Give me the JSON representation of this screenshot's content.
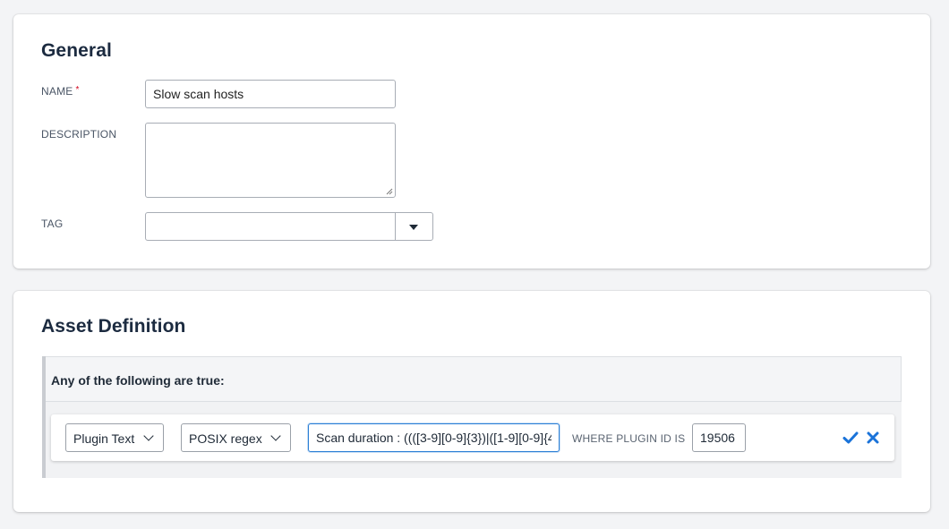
{
  "general": {
    "title": "General",
    "name_label": "NAME",
    "required_marker": "*",
    "name_value": "Slow scan hosts",
    "description_label": "DESCRIPTION",
    "description_value": "",
    "tag_label": "TAG",
    "tag_value": ""
  },
  "asset_definition": {
    "title": "Asset Definition",
    "condition_header": "Any of the following are true:",
    "rule": {
      "field_select": "Plugin Text",
      "operator_select": "POSIX regex",
      "value": "Scan duration : ((([3-9][0-9]{3})|([1-9][0-9]{4",
      "where_label": "WHERE PLUGIN ID IS",
      "plugin_id": "19506",
      "confirm_icon": "check-icon",
      "remove_icon": "close-icon"
    }
  },
  "colors": {
    "accent": "#2b7fd6",
    "required": "#d0021b",
    "title": "#1c2b40"
  }
}
